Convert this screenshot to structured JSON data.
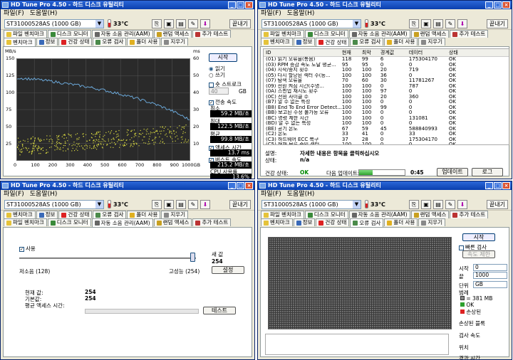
{
  "app": {
    "title": "HD Tune Pro 4.50 - 하드 디스크 유틸리티",
    "menu": [
      "파일(F)",
      "도움말(H)"
    ],
    "drive": "ST31000528AS (1000 GB)",
    "temperature": "33℃",
    "exit_label": "끝내기"
  },
  "tabs_top": [
    "파일 벤치마크",
    "디스크 모니터",
    "자동 소음 관리(AAM)",
    "랜덤 액세스",
    "추가 테스트"
  ],
  "tabs_bottom": [
    "벤치마크",
    "정보",
    "건강 상태",
    "오류 검사",
    "폴더 사용",
    "지우기"
  ],
  "benchmark": {
    "y_unit_left": "MB/s",
    "y_unit_right": "ms",
    "start_label": "시작",
    "read_label": "읽기",
    "write_label": "쓰기",
    "short_stroke_label": "숏 스트로크",
    "short_stroke_value": "40",
    "short_stroke_unit": "GB",
    "transfer_label": "전송 속도",
    "min_label": "최소",
    "min_value": "59.2 MB/초",
    "max_label": "최대",
    "max_value": "122.5 MB/초",
    "avg_label": "평균",
    "avg_value": "99.8 MB/초",
    "access_label": "액세스 시간",
    "access_value": "13.7 ms",
    "burst_label": "버스트 속도",
    "burst_value": "215.2 MB/초",
    "cpu_label": "CPU 사용률",
    "cpu_value": "13.6%"
  },
  "chart_data": {
    "type": "line",
    "x_unit": "GB",
    "x_ticks": [
      "0",
      "100",
      "200",
      "300",
      "400",
      "500",
      "600",
      "700",
      "800",
      "900",
      "1000GB"
    ],
    "y_left_ticks": [
      "150",
      "125",
      "100",
      "75",
      "50",
      "25"
    ],
    "y_right_ticks": [
      "60",
      "50",
      "40",
      "30",
      "20",
      "10"
    ],
    "ylim_left": [
      0,
      150
    ],
    "ylim_right": [
      0,
      60
    ],
    "xlim": [
      0,
      1000
    ],
    "series": [
      {
        "name": "전송 속도",
        "color": "#6aa6d6",
        "x": [
          0,
          100,
          200,
          300,
          400,
          500,
          600,
          700,
          800,
          900,
          1000
        ],
        "y": [
          122,
          120,
          117,
          113,
          109,
          104,
          98,
          91,
          83,
          73,
          60
        ]
      },
      {
        "name": "액세스 시간",
        "color": "#d8d840",
        "type": "scatter",
        "x_range": [
          0,
          1000
        ],
        "y_range_ms": [
          3,
          22
        ]
      }
    ]
  },
  "smart": {
    "headers": [
      "ID",
      "현재",
      "최악",
      "경계값",
      "데이터",
      "상태"
    ],
    "rows": [
      [
        "(01) 읽기 오류율(통음)",
        "118",
        "99",
        "6",
        "175304170",
        "OK"
      ],
      [
        "(03) RPM 증감 속도 도달 평균...",
        "95",
        "95",
        "0",
        "0",
        "OK"
      ],
      [
        "(04) 시작/중지 횟수",
        "100",
        "100",
        "20",
        "719",
        "OK"
      ],
      [
        "(05) 다시 할당된 섹터 수(등...",
        "100",
        "100",
        "36",
        "0",
        "OK"
      ],
      [
        "(07) 탐색 오류율",
        "70",
        "60",
        "30",
        "11781267",
        "OK"
      ],
      [
        "(09) 전원 켜짐 시간(수명...",
        "100",
        "100",
        "0",
        "787",
        "OK"
      ],
      [
        "(0A) 스핀업 재시도 횟수",
        "100",
        "100",
        "97",
        "0",
        "OK"
      ],
      [
        "(0C) 전원 사이클 수",
        "100",
        "100",
        "20",
        "360",
        "OK"
      ],
      [
        "(B7) 알 수 없는 특성",
        "100",
        "100",
        "0",
        "0",
        "OK"
      ],
      [
        "(B8) End To End Error Detect...",
        "100",
        "100",
        "99",
        "0",
        "OK"
      ],
      [
        "(BB) 보고된 수정 불가능 오류",
        "100",
        "100",
        "0",
        "0",
        "OK"
      ],
      [
        "(BC) 명령 제한 시간",
        "100",
        "100",
        "0",
        "131081",
        "OK"
      ],
      [
        "(BD) 알 수 없는 특성",
        "100",
        "100",
        "0",
        "0",
        "OK"
      ],
      [
        "(BE) 공기 온도",
        "67",
        "59",
        "45",
        "588840993",
        "OK"
      ],
      [
        "(C2) 온도",
        "33",
        "41",
        "0",
        "33",
        "OK"
      ],
      [
        "(C3) 하드웨어 ECC 복구",
        "37",
        "28",
        "0",
        "175304170",
        "OK"
      ],
      [
        "(C5) 현재 보류 중인 섹터",
        "100",
        "100",
        "0",
        "0",
        "OK"
      ],
      [
        "(C6) 오프라인 수정 불가능",
        "100",
        "100",
        "0",
        "0",
        "OK"
      ]
    ],
    "desc_label": "설명:",
    "desc_value": "자세한 내용은 항목을 클릭하십시오",
    "state_label": "상태:",
    "state_value": "n/a",
    "health_label": "건강 상태:",
    "health_value": "OK",
    "next_update_label": "다음 업데이트:",
    "next_update_time": "0:45",
    "update_button": "업데이트",
    "log_button": "로그"
  },
  "aam": {
    "use_label": "사용",
    "slider_low": "저소음 (128)",
    "slider_high": "고성능 (254)",
    "new_value_label": "새 값",
    "new_value": "254",
    "apply_button": "설정",
    "current_label": "현재 값:",
    "current_value": "254",
    "recommended_label": "기본값:",
    "recommended_value": "254",
    "avg_access_label": "평균 액세스 시간:",
    "test_button": "테스트"
  },
  "errorscan": {
    "start_label": "시작",
    "quick_scan_label": "빠른 검사",
    "stop_label": "속도 제한",
    "start_pos_label": "시작",
    "start_pos_value": "0",
    "end_pos_label": "끝",
    "end_pos_value": "1000",
    "unit_label": "단위",
    "unit_value": "GB",
    "legend_title": "범례",
    "legend_block": "= 381 MB",
    "legend_ok": "OK",
    "legend_bad": "손상된",
    "damaged_label": "손상된 블록",
    "speed_label": "검사 속도",
    "position_label": "위치",
    "elapsed_label": "경과 시간"
  }
}
